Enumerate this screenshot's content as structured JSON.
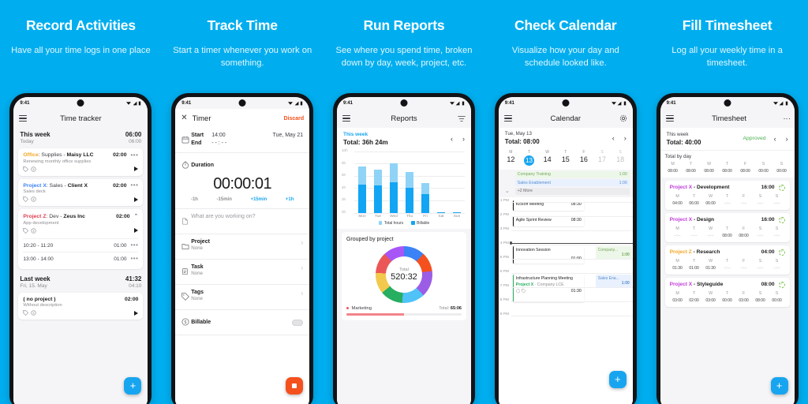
{
  "theme": {
    "brand_blue": "#00AEEF",
    "accent_blue": "#18A5F0",
    "orange": "#F4511E",
    "green": "#4CAF50"
  },
  "panels": [
    {
      "title": "Record Activities",
      "subtitle": "Have all your time logs in one place"
    },
    {
      "title": "Track Time",
      "subtitle": "Start a timer whenever you work on something."
    },
    {
      "title": "Run Reports",
      "subtitle": "See where you spend time, broken down by day, week, project, etc."
    },
    {
      "title": "Check Calendar",
      "subtitle": "Visualize how your day and schedule looked like."
    },
    {
      "title": "Fill Timesheet",
      "subtitle": "Log all your weekly time in a timesheet."
    }
  ],
  "status_bar": {
    "time": "9:41"
  },
  "tracker": {
    "appbar_title": "Time tracker",
    "this_week_label": "This week",
    "this_week_total": "06:00",
    "today_label": "Today",
    "today_total": "06:00",
    "entries": [
      {
        "project": "Office",
        "project_color": "#F5A623",
        "middle": ": Supplies - ",
        "client": "Maisy LLC",
        "description": "Renewing monthly office supplies",
        "duration": "02:00",
        "caret": "dots"
      },
      {
        "project": "Project X",
        "project_color": "#3B82F6",
        "middle": ": Sales - ",
        "client": "Client X",
        "description": "Sales deck",
        "duration": "02:00",
        "caret": "dots"
      },
      {
        "project": "Project Z",
        "project_color": "#E03B4E",
        "middle": ": Dev - ",
        "client": "Zeus Inc",
        "description": "App development",
        "duration": "02:00",
        "caret": "up"
      }
    ],
    "sub_entries": [
      {
        "range": "10:20 - 11:20",
        "duration": "01:00"
      },
      {
        "range": "13:00 - 14:00",
        "duration": "01:00"
      }
    ],
    "last_week_label": "Last week",
    "last_week_total": "41:32",
    "last_week_day": "Fri, 15. May",
    "last_week_day_total": "04:10",
    "no_project_entry": {
      "title": "( no project )",
      "description": "Without description",
      "duration": "02:00"
    },
    "fab_label": "+"
  },
  "timer": {
    "appbar_title": "Timer",
    "discard_label": "Discard",
    "start_label": "Start",
    "start_value": "14:00",
    "end_label": "End",
    "end_value": "- - : - -",
    "date_value": "Tue, May 21",
    "duration_label": "Duration",
    "duration_value": "00:00:01",
    "adjustments": [
      "-1h",
      "-15min",
      "+15min",
      "+1h"
    ],
    "note_placeholder": "What are you working on?",
    "fields": [
      {
        "label": "Project",
        "value": "None",
        "icon": "folder-icon"
      },
      {
        "label": "Task",
        "value": "None",
        "icon": "clipboard-icon"
      },
      {
        "label": "Tags",
        "value": "None",
        "icon": "tag-icon"
      }
    ],
    "billable_label": "Billable",
    "stop_label": "stop"
  },
  "reports": {
    "appbar_title": "Reports",
    "week_label": "This week",
    "total_label": "Total: 36h 24m",
    "grouped_title": "Grouped by project",
    "donut_center_label": "Total",
    "donut_center_value": "520:32",
    "marketing_label": "Marketing",
    "marketing_total_prefix": "Total: ",
    "marketing_total": "65:06",
    "marketing_bar_pct": 50
  },
  "chart_data": {
    "type": "bar",
    "title": "Total: 36h 24m",
    "subtitle": "This week",
    "categories": [
      "Mon",
      "Tue",
      "Wed",
      "Thu",
      "Fri",
      "Sat",
      "Sun"
    ],
    "series": [
      {
        "name": "Billable",
        "color": "#12A5F4",
        "values": [
          4.6,
          4.4,
          5.0,
          4.1,
          3.0,
          0.08,
          0.08
        ]
      },
      {
        "name": "Total hours",
        "color": "#8FD3F7",
        "values": [
          7.5,
          7.0,
          8.0,
          6.6,
          4.8,
          0.1,
          0.1
        ]
      }
    ],
    "stacked": true,
    "ylabel": "",
    "xlabel": "",
    "ylim": [
      0,
      10
    ],
    "yticks": [
      "0h",
      "2h",
      "4h",
      "6h",
      "8h",
      "10h"
    ],
    "grid": true,
    "legend": [
      "Total hours",
      "Billable"
    ],
    "legend_position": "bottom"
  },
  "donut_data": {
    "type": "pie",
    "center_label": "Total",
    "center_value": "520:32",
    "slices": [
      {
        "color": "#3B82F6",
        "pct": 12
      },
      {
        "color": "#F4511E",
        "pct": 11
      },
      {
        "color": "#9B5DE5",
        "pct": 15
      },
      {
        "color": "#4FC3F7",
        "pct": 13
      },
      {
        "color": "#27AE60",
        "pct": 13
      },
      {
        "color": "#F2C94C",
        "pct": 12
      },
      {
        "color": "#EB5757",
        "pct": 12
      },
      {
        "color": "#A855F7",
        "pct": 12
      }
    ]
  },
  "calendar": {
    "appbar_title": "Calendar",
    "date_label": "Tue, May 13",
    "total_label": "Total: 08:00",
    "days": [
      {
        "dow": "M",
        "num": "12",
        "selected": false,
        "dim": false
      },
      {
        "dow": "T",
        "num": "13",
        "selected": true,
        "dim": false
      },
      {
        "dow": "W",
        "num": "14",
        "selected": false,
        "dim": false
      },
      {
        "dow": "T",
        "num": "15",
        "selected": false,
        "dim": false
      },
      {
        "dow": "F",
        "num": "16",
        "selected": false,
        "dim": false
      },
      {
        "dow": "S",
        "num": "17",
        "selected": false,
        "dim": true
      },
      {
        "dow": "S",
        "num": "18",
        "selected": false,
        "dim": true
      }
    ],
    "allday": [
      {
        "name": "Company Training",
        "duration": "1:00",
        "bg": "#EDF7E9",
        "fg": "#76A85A"
      },
      {
        "name": "Sales Enablement",
        "duration": "1:00",
        "bg": "#E8F1FD",
        "fg": "#5A8BD0"
      },
      {
        "name": "+2 More",
        "duration": "",
        "bg": "#ECECEE",
        "fg": "#6d6d72"
      }
    ],
    "hours": [
      "1 PM",
      "2 PM",
      "3 PM",
      "4 PM",
      "5 PM",
      "6 PM",
      "7 PM",
      "8 PM",
      "9 PM"
    ],
    "events": [
      {
        "title": "Kickoff Meeting",
        "duration": "08:30",
        "bar": "#1c1c1e"
      },
      {
        "title": "Agile Sprint Review",
        "duration": "08:30",
        "bar": "#1c1c1e"
      },
      {
        "title": "Innovation Session",
        "duration": "01:00",
        "bar": "#1c1c1e"
      },
      {
        "title": "Infrastructure Planning Meeting",
        "project": "Project X",
        "project_client": " · Company LCE",
        "duration": "01:30",
        "bar": "#27AE60",
        "project_color": "#27AE60"
      }
    ],
    "side_events": [
      {
        "name": "Company...",
        "duration": "1:00",
        "bg": "#EDF7E9",
        "fg": "#76A85A"
      },
      {
        "name": "Sales Ena...",
        "duration": "1:00",
        "bg": "#E8F1FD",
        "fg": "#5A8BD0"
      }
    ],
    "fab_label": "+"
  },
  "timesheet": {
    "appbar_title": "Timesheet",
    "week_label": "This week",
    "total_label": "Total: 40:00",
    "approved_label": "Approved",
    "byday_label": "Total by day",
    "day_headers": [
      "M",
      "T",
      "W",
      "T",
      "F",
      "S",
      "S"
    ],
    "byday_values": [
      "08:00",
      "08:00",
      "08:00",
      "08:00",
      "08:00",
      "00:00",
      "00:00"
    ],
    "rows": [
      {
        "project": "Project X",
        "project_color": "#C23BDB",
        "task": " - Development",
        "duration": "16:00",
        "values": [
          "04:00",
          "06:00",
          "06:00",
          "--:--",
          "--:--",
          "--:--",
          "--:--"
        ]
      },
      {
        "project": "Project X",
        "project_color": "#C23BDB",
        "task": " - Design",
        "duration": "16:00",
        "values": [
          "--:--",
          "--:--",
          "--:--",
          "08:00",
          "08:00",
          "--:--",
          "--:--"
        ]
      },
      {
        "project": "Project Z",
        "project_color": "#F5A623",
        "task": " - Research",
        "duration": "04:00",
        "values": [
          "01:30",
          "01:00",
          "01:30",
          "--:--",
          "--:--",
          "--:--",
          "--:--"
        ]
      },
      {
        "project": "Project X",
        "project_color": "#C23BDB",
        "task": " - Styleguide",
        "duration": "08:00",
        "values": [
          "03:00",
          "02:00",
          "03:00",
          "00:00",
          "03:00",
          "08:00",
          "00:00"
        ]
      }
    ],
    "fab_label": "+"
  }
}
